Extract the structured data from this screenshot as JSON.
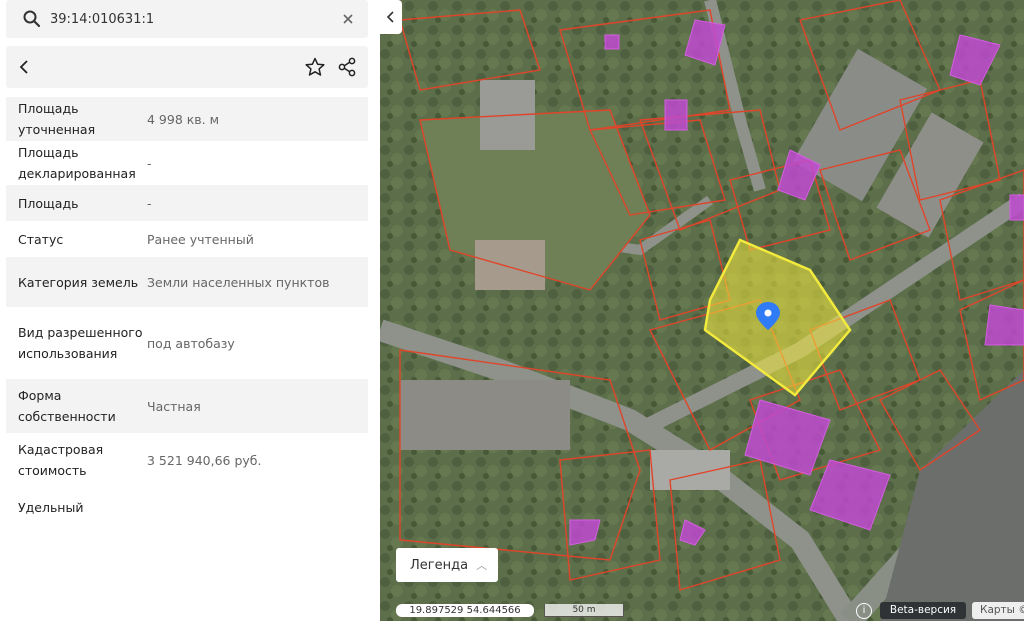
{
  "search": {
    "value": "39:14:010631:1"
  },
  "properties": [
    {
      "key": "Площадь уточненная",
      "value": "4 998 кв. м"
    },
    {
      "key": "Площадь декларированная",
      "value": "-"
    },
    {
      "key": "Площадь",
      "value": "-"
    },
    {
      "key": "Статус",
      "value": "Ранее учтенный"
    },
    {
      "key": "Категория земель",
      "value": "Земли населенных пунктов"
    },
    {
      "key": "Вид разрешенного использования",
      "value": "под автобазу"
    },
    {
      "key": "Форма собственности",
      "value": "Частная"
    },
    {
      "key": "Кадастровая стоимость",
      "value": "3 521 940,66 руб."
    },
    {
      "key": "Удельный",
      "value": ""
    }
  ],
  "map": {
    "legend_label": "Легенда",
    "coordinates": "19.897529  54.644566",
    "scale": "50 m",
    "beta_label": "Beta-версия",
    "maps_label": "Карты ©"
  },
  "colors": {
    "selected_parcel": "#f2ea3c",
    "parcel_border": "#e0452a",
    "building": "#c04ad0",
    "marker": "#2f7cf6"
  }
}
